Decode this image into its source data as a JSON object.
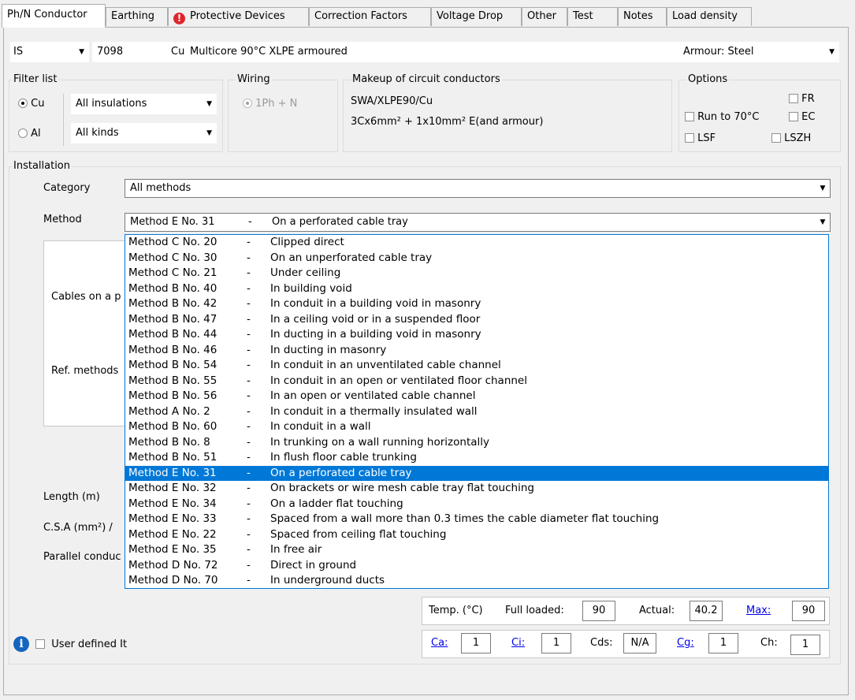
{
  "tabs": [
    {
      "label": "Ph/N Conductor",
      "active": true
    },
    {
      "label": "Earthing"
    },
    {
      "label": "Protective Devices",
      "warning": true
    },
    {
      "label": "Correction Factors"
    },
    {
      "label": "Voltage Drop"
    },
    {
      "label": "Other"
    },
    {
      "label": "Test"
    },
    {
      "label": "Notes"
    },
    {
      "label": "Load density"
    }
  ],
  "header": {
    "standard": "IS",
    "code": "7098",
    "material": "Cu",
    "description": "Multicore 90°C XLPE armoured",
    "armour": "Armour: Steel"
  },
  "filter": {
    "title": "Filter list",
    "cu": "Cu",
    "al": "Al",
    "insulation": "All insulations",
    "kind": "All kinds"
  },
  "wiring": {
    "title": "Wiring",
    "option": "1Ph + N"
  },
  "makeup": {
    "title": "Makeup of circuit conductors",
    "line1": "SWA/XLPE90/Cu",
    "line2": "3Cx6mm² + 1x10mm² E(and armour)"
  },
  "options": {
    "title": "Options",
    "fr": "FR",
    "run70": "Run to 70°C",
    "ec": "EC",
    "lsf": "LSF",
    "lszh": "LSZH"
  },
  "installation": {
    "title": "Installation",
    "category_label": "Category",
    "category_value": "All methods",
    "method_label": "Method",
    "method_code": "Method E No. 31",
    "method_dash": "-",
    "method_desc": "On a perforated cable tray",
    "cables_label": "Cables on a p",
    "ref_label": "Ref. methods",
    "length_label": "Length (m)",
    "csa_label": "C.S.A (mm²) /",
    "parallel_label": "Parallel conduc"
  },
  "methods": [
    {
      "code": "Method C No. 20",
      "desc": "Clipped direct"
    },
    {
      "code": "Method C No. 30",
      "desc": "On an unperforated cable tray"
    },
    {
      "code": "Method C No. 21",
      "desc": "Under ceiling"
    },
    {
      "code": "Method B No. 40",
      "desc": "In building void"
    },
    {
      "code": "Method B No. 42",
      "desc": "In conduit in a building void in masonry"
    },
    {
      "code": "Method B No. 47",
      "desc": "In a ceiling void or in a suspended floor"
    },
    {
      "code": "Method B No. 44",
      "desc": "In ducting in a building void in masonry"
    },
    {
      "code": "Method B No. 46",
      "desc": "In ducting in masonry"
    },
    {
      "code": "Method B No. 54",
      "desc": "In conduit in an unventilated cable channel"
    },
    {
      "code": "Method B No. 55",
      "desc": "In conduit in an open or ventilated floor channel"
    },
    {
      "code": "Method B No. 56",
      "desc": "In an open or ventilated cable channel"
    },
    {
      "code": "Method A No. 2",
      "desc": "In conduit in a thermally insulated wall"
    },
    {
      "code": "Method B No. 60",
      "desc": "In conduit in a wall"
    },
    {
      "code": "Method B No. 8",
      "desc": "In trunking on a wall running horizontally"
    },
    {
      "code": "Method B No. 51",
      "desc": "In flush floor cable trunking"
    },
    {
      "code": "Method E No. 31",
      "desc": "On a perforated cable tray",
      "selected": true
    },
    {
      "code": "Method E No. 32",
      "desc": "On brackets or wire mesh cable tray flat touching"
    },
    {
      "code": "Method E No. 34",
      "desc": "On a ladder flat touching"
    },
    {
      "code": "Method E No. 33",
      "desc": "Spaced from a wall more than 0.3 times the cable diameter flat touching"
    },
    {
      "code": "Method E No. 22",
      "desc": "Spaced from ceiling flat touching"
    },
    {
      "code": "Method E No. 35",
      "desc": "In free air"
    },
    {
      "code": "Method D No. 72",
      "desc": "Direct in ground"
    },
    {
      "code": "Method D No. 70",
      "desc": "In underground ducts"
    }
  ],
  "temp": {
    "label": "Temp. (°C)",
    "full_label": "Full loaded:",
    "full_value": "90",
    "actual_label": "Actual:",
    "actual_value": "40.2",
    "max_label": "Max:",
    "max_value": "90"
  },
  "factors": {
    "ca_label": "Ca:",
    "ca_value": "1",
    "ci_label": "Ci:",
    "ci_value": "1",
    "cds_label": "Cds:",
    "cds_value": "N/A",
    "cg_label": "Cg:",
    "cg_value": "1",
    "ch_label": "Ch:",
    "ch_value": "1"
  },
  "user_defined": "User defined It"
}
